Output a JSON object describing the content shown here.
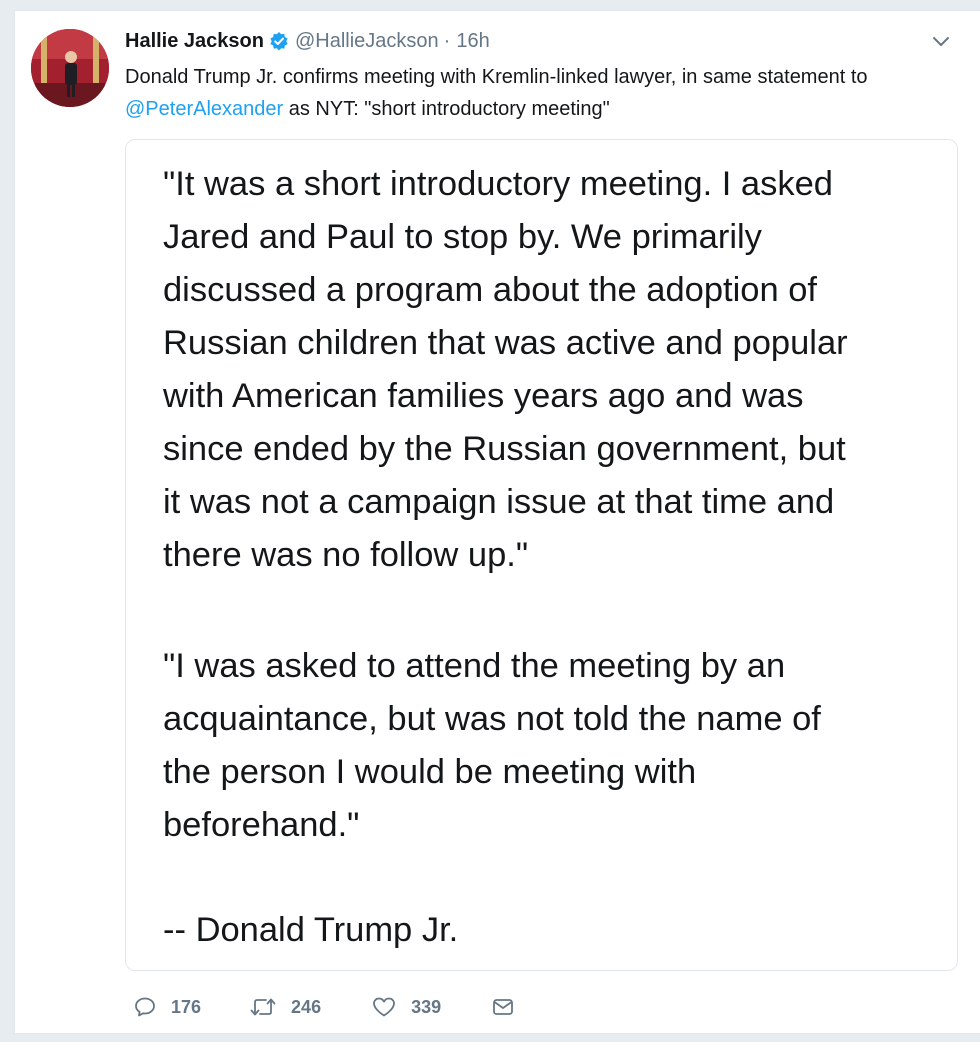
{
  "tweet": {
    "author_name": "Hallie Jackson",
    "handle": "@HallieJackson",
    "separator": "·",
    "time": "16h",
    "text_before": "Donald Trump Jr. confirms meeting with Kremlin-linked lawyer, in same statement to ",
    "mention": "@PeterAlexander",
    "text_after": " as NYT: \"short introductory meeting\""
  },
  "quote_image": {
    "paragraph_1_lines": [
      "\"It was a short introductory meeting. I asked",
      "Jared and Paul to stop by. We primarily",
      "discussed a program about the adoption of",
      "Russian children that was active and popular",
      "with American families years ago and was",
      "since ended by the Russian government, but",
      "it was not a campaign issue at that time and",
      "there was no follow up.\""
    ],
    "paragraph_2_lines": [
      "\"I was asked to attend the meeting by an",
      "acquaintance, but was not told the name of",
      "the person I would be meeting with",
      "beforehand.\""
    ],
    "signature": "-- Donald Trump Jr."
  },
  "actions": {
    "reply_count": "176",
    "retweet_count": "246",
    "like_count": "339"
  },
  "icons": {
    "verified": "verified-badge-icon",
    "caret": "chevron-down-icon",
    "reply": "reply-icon",
    "retweet": "retweet-icon",
    "like": "heart-icon",
    "message": "direct-message-icon"
  },
  "colors": {
    "link": "#1da1f2",
    "muted": "#657786",
    "text": "#14171a",
    "border": "#e1e8ed",
    "background": "#e6ecf0"
  }
}
